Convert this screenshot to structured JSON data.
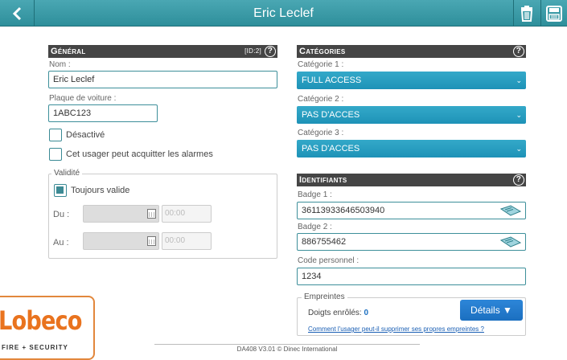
{
  "header": {
    "title": "Eric Leclef"
  },
  "general": {
    "heading": "Général",
    "id_tag": "[ID:2]",
    "name_label": "Nom :",
    "name_value": "Eric Leclef",
    "plate_label": "Plaque de voiture :",
    "plate_value": "1ABC123",
    "disabled_label": "Désactivé",
    "alarm_label": "Cet usager peut acquitter les alarmes",
    "validity_legend": "Validité",
    "always_valid_label": "Toujours valide",
    "from_label": "Du :",
    "to_label": "Au :",
    "from_time": "00:00",
    "to_time": "00:00"
  },
  "categories": {
    "heading": "Catégories",
    "cat1_label": "Catégorie 1 :",
    "cat1_value": "FULL ACCESS",
    "cat2_label": "Catégorie 2 :",
    "cat2_value": "PAS D'ACCES",
    "cat3_label": "Catégorie 3 :",
    "cat3_value": "PAS D'ACCES"
  },
  "identifiers": {
    "heading": "Identifiants",
    "badge1_label": "Badge 1 :",
    "badge1_value": "36113933646503940",
    "badge2_label": "Badge 2 :",
    "badge2_value": "886755462",
    "code_label": "Code personnel :",
    "code_value": "1234",
    "fingerprints_legend": "Empreintes",
    "fingers_enrolled_label": "Doigts enrôlés:",
    "fingers_enrolled_count": "0",
    "details_label": "Détails ▼",
    "self_delete_link": "Comment l'usager peut-il supprimer ses propres empreintes ?"
  },
  "logo": {
    "name": "Lobeco",
    "tagline": "FIRE + SECURITY"
  },
  "footer": {
    "text": "DA408 V3.01 © Dinec International"
  },
  "colors": {
    "accent": "#3d9aa6",
    "select_blue": "#2a9fc3",
    "logo_orange": "#e9731e"
  }
}
